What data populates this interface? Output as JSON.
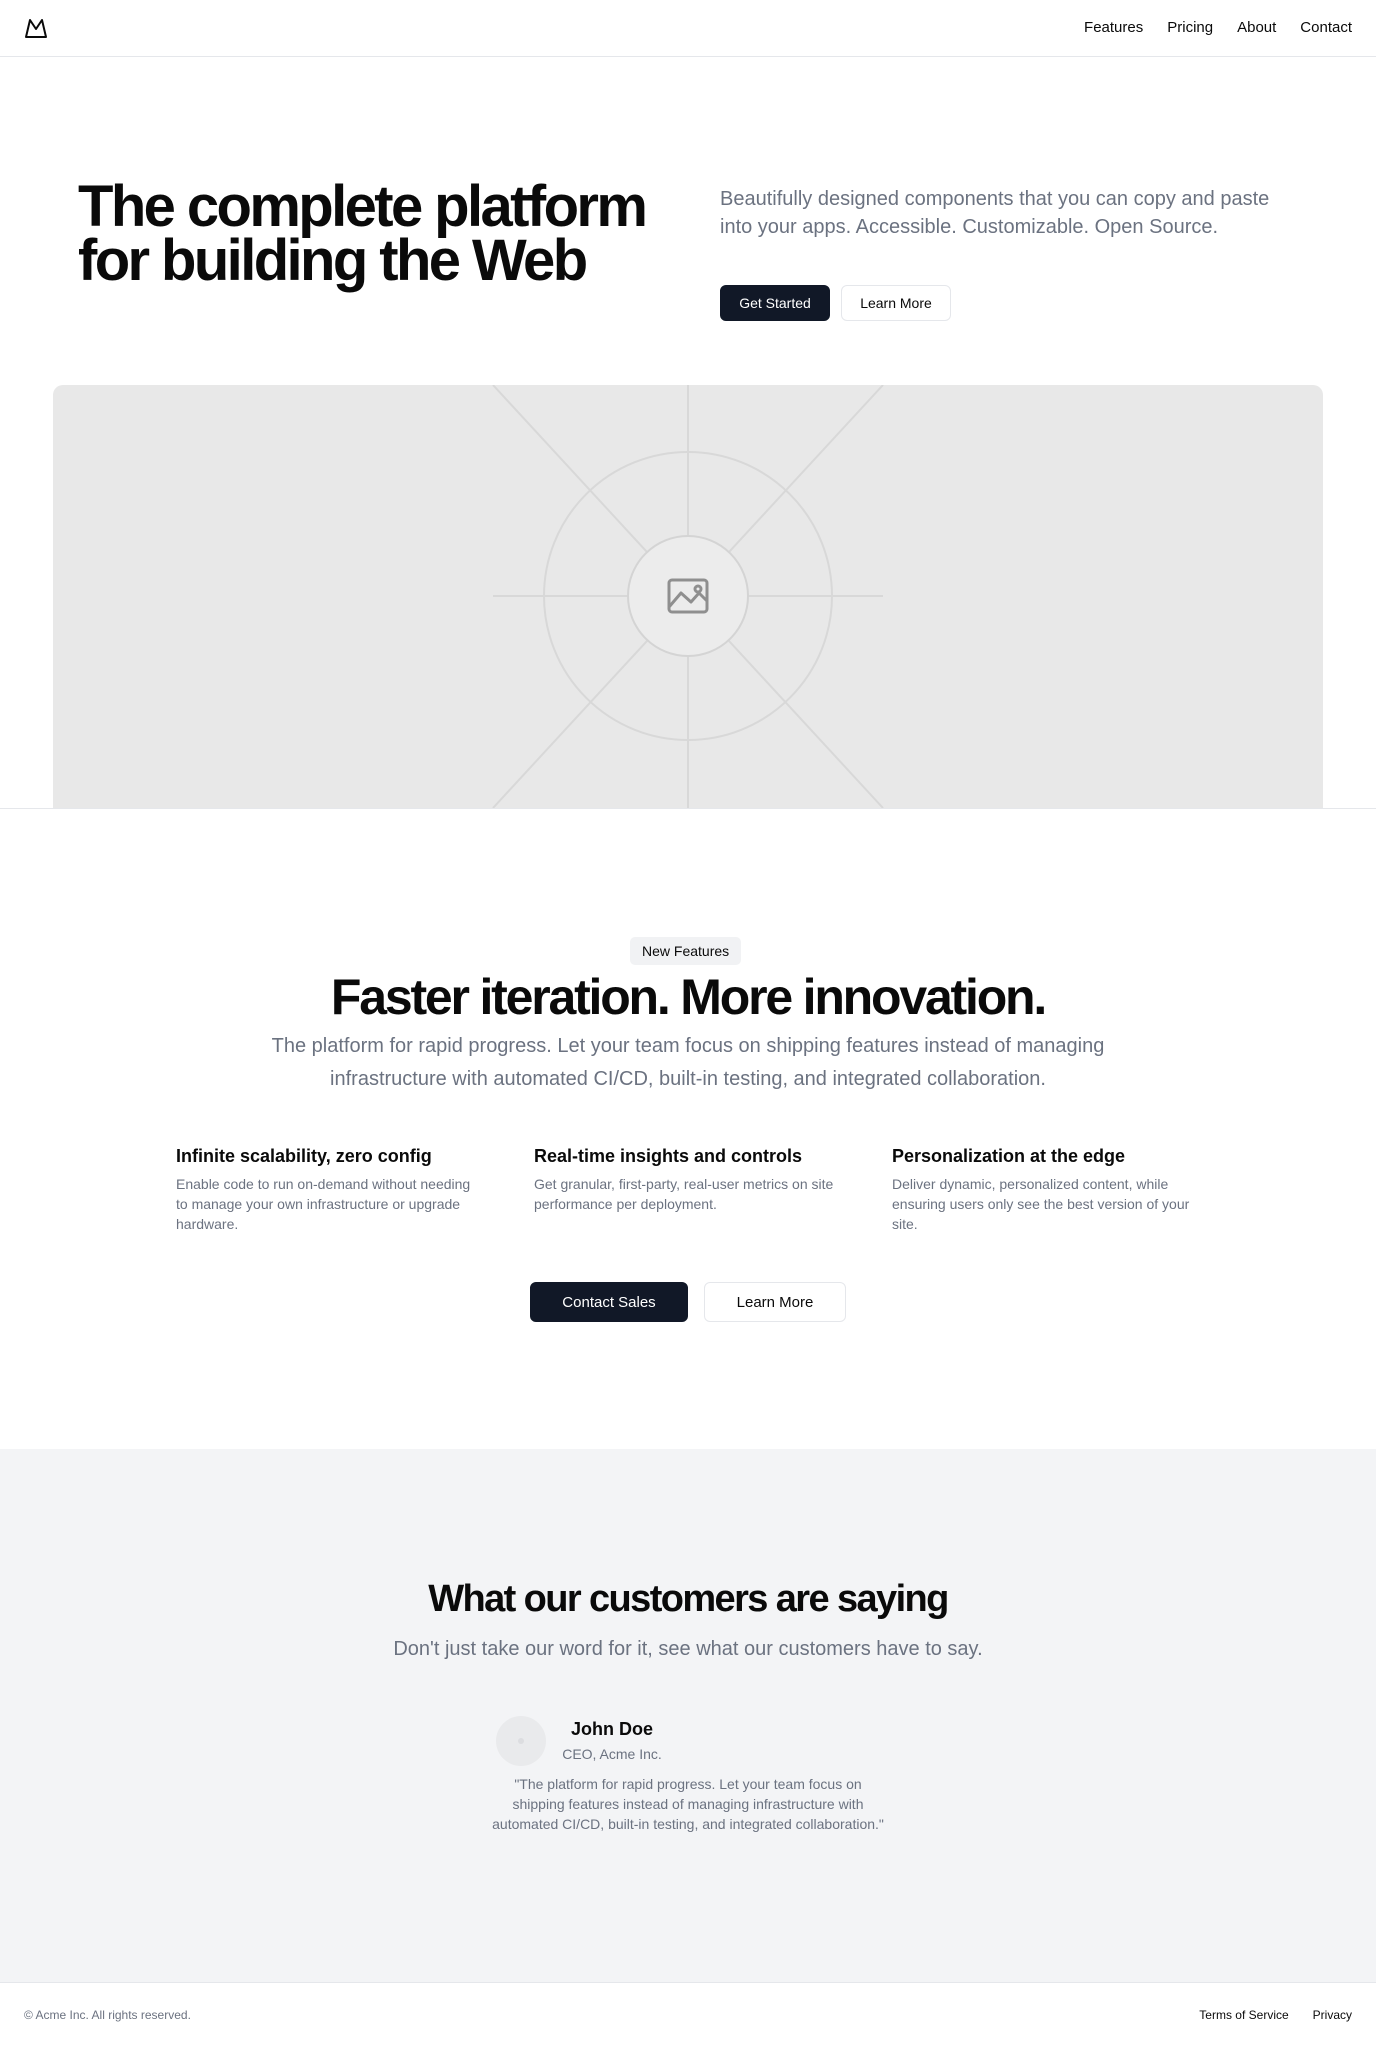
{
  "header": {
    "logo_icon": "mountain-icon",
    "nav": [
      "Features",
      "Pricing",
      "About",
      "Contact"
    ]
  },
  "hero": {
    "title_line1": "The complete platform",
    "title_line2": "for building the Web",
    "subtitle": "Beautifully designed components that you can copy and paste into your apps. Accessible. Customizable. Open Source.",
    "primary_button": "Get Started",
    "secondary_button": "Learn More",
    "image_icon": "image-placeholder-icon"
  },
  "features": {
    "badge": "New Features",
    "title": "Faster iteration. More innovation.",
    "subtitle": "The platform for rapid progress. Let your team focus on shipping features instead of managing infrastructure with automated CI/CD, built-in testing, and integrated collaboration.",
    "items": [
      {
        "title": "Infinite scalability, zero config",
        "text": "Enable code to run on-demand without needing to manage your own infrastructure or upgrade hardware."
      },
      {
        "title": "Real-time insights and controls",
        "text": "Get granular, first-party, real-user metrics on site performance per deployment."
      },
      {
        "title": "Personalization at the edge",
        "text": "Deliver dynamic, personalized content, while ensuring users only see the best version of your site."
      }
    ],
    "primary_button": "Contact Sales",
    "secondary_button": "Learn More"
  },
  "testimonials": {
    "title": "What our customers are saying",
    "subtitle": "Don't just take our word for it, see what our customers have to say.",
    "name": "John Doe",
    "role": "CEO, Acme Inc.",
    "quote": "\"The platform for rapid progress. Let your team focus on shipping features instead of managing infrastructure with automated CI/CD, built-in testing, and integrated collaboration.\""
  },
  "footer": {
    "copyright": "© Acme Inc. All rights reserved.",
    "links": [
      "Terms of Service",
      "Privacy"
    ]
  },
  "colors": {
    "primary": "#111827",
    "muted_text": "#6b7280",
    "section_bg": "#f3f4f6",
    "border": "#e5e7eb"
  }
}
